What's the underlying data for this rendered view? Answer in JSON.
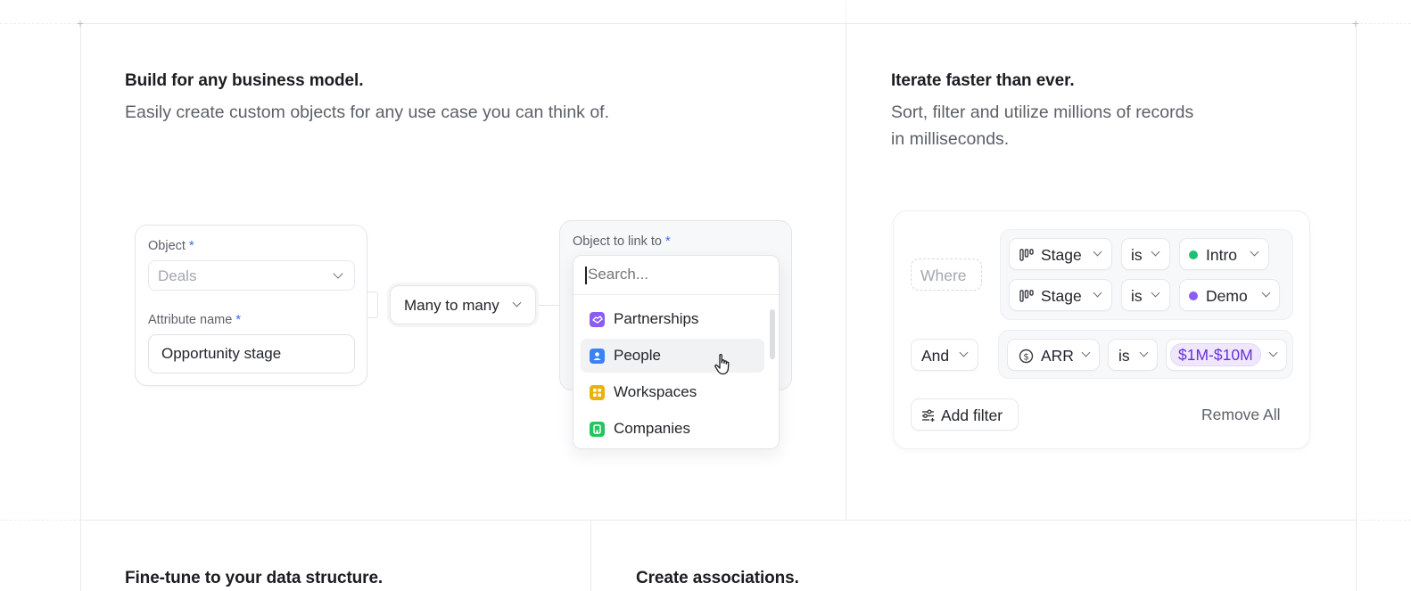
{
  "left_section": {
    "title": "Build for any business model.",
    "subtitle": "Easily create custom objects for any use case you can think of.",
    "object_form": {
      "object_label": "Object",
      "object_value": "Deals",
      "attribute_label": "Attribute name",
      "attribute_value": "Opportunity stage",
      "required_mark": "*"
    },
    "relationship": {
      "label": "Many to many"
    },
    "link_form": {
      "label": "Object to link to",
      "required_mark": "*",
      "search_placeholder": "Search...",
      "items": [
        {
          "label": "Partnerships",
          "icon": "handshake-icon",
          "color": "#8b5cf6",
          "active": false
        },
        {
          "label": "People",
          "icon": "person-icon",
          "color": "#3b82f6",
          "active": true
        },
        {
          "label": "Workspaces",
          "icon": "grid-icon",
          "color": "#eab308",
          "active": false
        },
        {
          "label": "Companies",
          "icon": "building-icon",
          "color": "#22c55e",
          "active": false
        }
      ]
    }
  },
  "right_section": {
    "title": "Iterate faster than ever.",
    "subtitle_line1": "Sort, filter and utilize millions of records",
    "subtitle_line2": "in milliseconds.",
    "filters": {
      "where_label": "Where",
      "and_label": "And",
      "rows": [
        {
          "attribute": "Stage",
          "operator": "is",
          "value": "Intro",
          "value_color": "#1fbf75"
        },
        {
          "attribute": "Stage",
          "operator": "is",
          "value": "Demo",
          "value_color": "#8b5cf6"
        }
      ],
      "arr_row": {
        "attribute": "ARR",
        "operator": "is",
        "value": "$1M-$10M"
      },
      "add_filter_label": "Add filter",
      "remove_all_label": "Remove All"
    }
  },
  "bottom_left": {
    "title": "Fine-tune to your data structure."
  },
  "bottom_right": {
    "title": "Create associations."
  }
}
